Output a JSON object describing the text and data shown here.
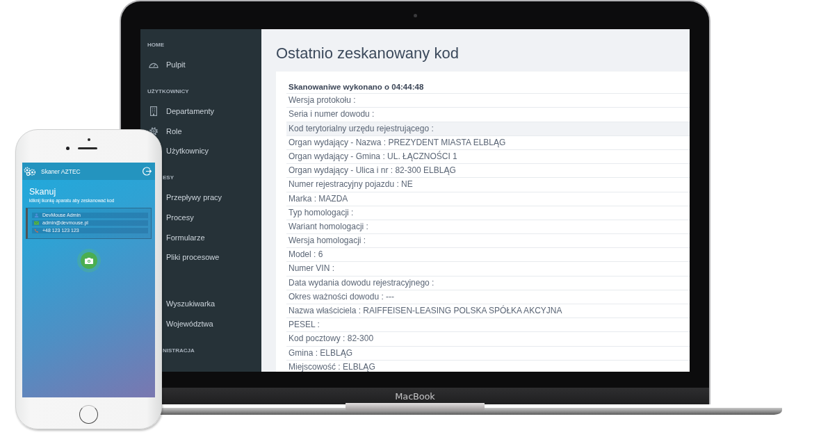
{
  "laptop": {
    "brand": "MacBook",
    "sidebar": {
      "sections": [
        {
          "title": "HOME",
          "covered": false,
          "items": [
            {
              "label": "Pulpit"
            }
          ]
        },
        {
          "title": "UŻYTKOWNICY",
          "covered": false,
          "items": [
            {
              "label": "Departamenty"
            },
            {
              "label": "Role"
            },
            {
              "label": "Użytkownicy"
            }
          ]
        },
        {
          "title": "ESY",
          "covered": true,
          "items": [
            {
              "label": "Przepływy pracy"
            },
            {
              "label": "Procesy"
            },
            {
              "label": "Formularze"
            },
            {
              "label": "Pliki procesowe"
            }
          ]
        },
        {
          "items": [
            {
              "label": "Wyszukiwarka"
            },
            {
              "label": "Województwa"
            }
          ]
        },
        {
          "title": "NISTRACJA",
          "covered": true
        }
      ]
    },
    "page": {
      "title": "Ostatnio zeskanowany kod",
      "scan_card": {
        "heading": "Skanowaniwe wykonano o 04:44:48",
        "rows": [
          {
            "text": "Wersja protokołu :",
            "highlighted": false
          },
          {
            "text": "Seria i numer dowodu :",
            "highlighted": false
          },
          {
            "text": "Kod terytorialny urzędu rejestrującego :",
            "highlighted": true
          },
          {
            "text": "Organ wydający - Nazwa : PREZYDENT MIASTA ELBLĄG",
            "highlighted": false
          },
          {
            "text": "Organ wydający - Gmina : UL. ŁĄCZNOŚCI 1",
            "highlighted": false
          },
          {
            "text": "Organ wydający - Ulica i nr : 82-300 ELBLĄG",
            "highlighted": false
          },
          {
            "text": "Numer rejestracyjny pojazdu : NE",
            "highlighted": false
          },
          {
            "text": "Marka : MAZDA",
            "highlighted": false
          },
          {
            "text": "Typ homologacji :",
            "highlighted": false
          },
          {
            "text": "Wariant homologacji :",
            "highlighted": false
          },
          {
            "text": "Wersja homologacji :",
            "highlighted": false
          },
          {
            "text": "Model : 6",
            "highlighted": false
          },
          {
            "text": "Numer VIN :",
            "highlighted": false
          },
          {
            "text": "Data wydania dowodu rejestracyjnego :",
            "highlighted": false
          },
          {
            "text": "Okres ważności dowodu : ---",
            "highlighted": false
          },
          {
            "text": "Nazwa właściciela : RAIFFEISEN-LEASING POLSKA SPÓŁKA AKCYJNA",
            "highlighted": false
          },
          {
            "text": "PESEL :",
            "highlighted": false
          },
          {
            "text": "Kod pocztowy : 82-300",
            "highlighted": false
          },
          {
            "text": "Gmina : ELBLĄG",
            "highlighted": false
          },
          {
            "text": "Miejscowość : ELBLĄG",
            "highlighted": false
          }
        ]
      }
    }
  },
  "phone": {
    "app_title": "Skaner AZTEC",
    "screen_title": "Skanuj",
    "hint": "kliknij ikonkę aparatu aby zeskanować kod",
    "user_card": [
      {
        "kind": "name",
        "text": "DevMouse Admin"
      },
      {
        "kind": "email",
        "text": "admin@devmouse.pl"
      },
      {
        "kind": "phone",
        "text": "+48 123 123 123"
      }
    ]
  }
}
